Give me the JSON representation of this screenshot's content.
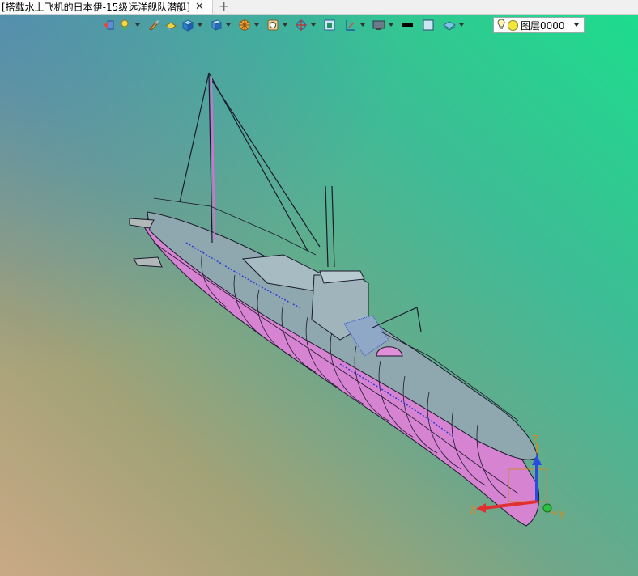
{
  "tab": {
    "title": "[搭载水上飞机的日本伊-15级远洋舰队潜艇]",
    "close": "✕",
    "new_tab": "+"
  },
  "toolbar": {
    "icons": [
      "undo-icon",
      "light-icon",
      "brush-icon",
      "box-flat-icon",
      "cube-icon",
      "view-cube-icon",
      "render-mode-icon",
      "zoom-icon",
      "rotate-icon",
      "fit-view-icon",
      "plane-icon",
      "display-icon",
      "line-style-icon",
      "fill-color-icon",
      "layers-icon"
    ]
  },
  "layer": {
    "name": "图层0000",
    "dot_color": "#f5e53b"
  },
  "axes": {
    "x": "X",
    "y": "Y",
    "z": "Z"
  },
  "colors": {
    "hull_top": "#8aa5ad",
    "hull_side": "#d57fd0",
    "edge": "#1a1a2a"
  }
}
